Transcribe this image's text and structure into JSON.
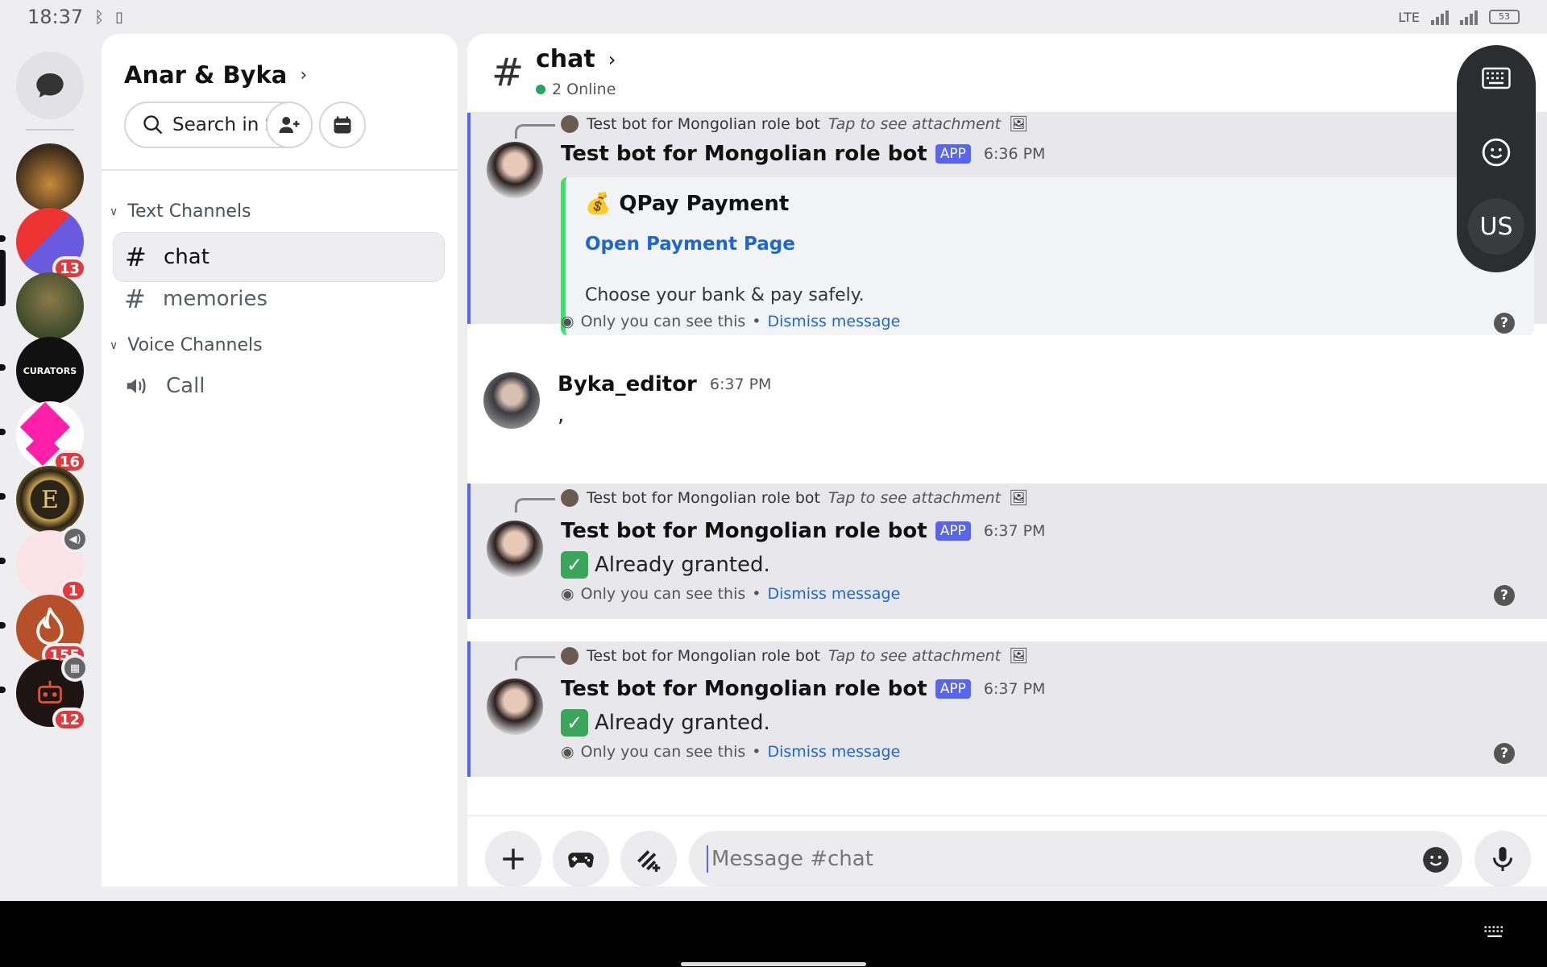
{
  "status_bar": {
    "time": "18:37",
    "network": "LTE",
    "battery": "53"
  },
  "server_rail": {
    "badges": [
      "13",
      "16",
      "1",
      "155",
      "12"
    ],
    "curators_text": "CURATORS"
  },
  "sidebar": {
    "server_name": "Anar & Byka",
    "search_placeholder": "Search in S...",
    "text_category": "Text Channels",
    "voice_category": "Voice Channels",
    "channels": [
      {
        "name": "chat"
      },
      {
        "name": "memories"
      }
    ],
    "voice_channels": [
      {
        "name": "Call"
      }
    ]
  },
  "header": {
    "channel": "chat",
    "online": "2 Online"
  },
  "messages": [
    {
      "reply_author": "Test bot for Mongolian role bot",
      "reply_text": "Tap to see attachment",
      "author": "Test bot for Mongolian role bot",
      "tag": "APP",
      "time": "6:36 PM",
      "embed": {
        "title": "QPay Payment",
        "link": "Open Payment Page",
        "description": "Choose your bank & pay safely."
      },
      "ephemeral_note": "Only you can see this",
      "dismiss": "Dismiss message"
    },
    {
      "author": "Byka_editor",
      "time": "6:37 PM",
      "text": ","
    },
    {
      "reply_author": "Test bot for Mongolian role bot",
      "reply_text": "Tap to see attachment",
      "author": "Test bot for Mongolian role bot",
      "tag": "APP",
      "time": "6:37 PM",
      "text": "Already granted.",
      "ephemeral_note": "Only you can see this",
      "dismiss": "Dismiss message"
    },
    {
      "reply_author": "Test bot for Mongolian role bot",
      "reply_text": "Tap to see attachment",
      "author": "Test bot for Mongolian role bot",
      "tag": "APP",
      "time": "6:37 PM",
      "text": "Already granted.",
      "ephemeral_note": "Only you can see this",
      "dismiss": "Dismiss message"
    }
  ],
  "composer": {
    "placeholder": "Message #chat"
  },
  "float_panel": {
    "lang": "US"
  },
  "colors": {
    "accent": "#5865f2",
    "embed_bar": "#3fe06b",
    "link": "#1e66d4",
    "badge": "#e03a3e",
    "online": "#23a55a"
  }
}
